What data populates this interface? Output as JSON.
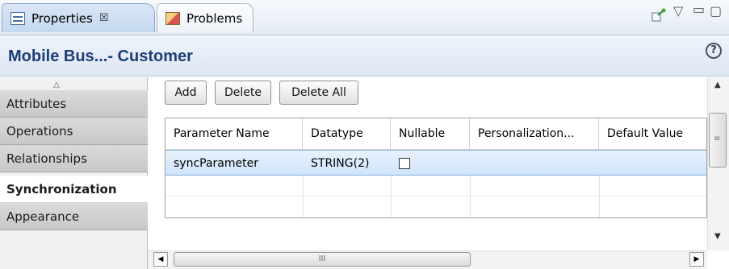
{
  "tabs": [
    {
      "label": "Properties",
      "close": "☒"
    },
    {
      "label": "Problems"
    }
  ],
  "toolbar": {
    "pin_icon": "pin-icon",
    "menu_icon": "▽",
    "minimize_icon": "▭",
    "maximize_icon": "▢"
  },
  "title": "Mobile Bus...- Customer",
  "help": "?",
  "nav": {
    "items": [
      {
        "label": "Attributes"
      },
      {
        "label": "Operations"
      },
      {
        "label": "Relationships"
      },
      {
        "label": "Synchronization"
      },
      {
        "label": "Appearance"
      }
    ],
    "selected": "Synchronization"
  },
  "buttons": {
    "add": "Add",
    "delete": "Delete",
    "delete_all": "Delete All"
  },
  "table": {
    "columns": [
      "Parameter Name",
      "Datatype",
      "Nullable",
      "Personalization...",
      "Default Value"
    ],
    "rows": [
      {
        "parameter_name": "syncParameter",
        "datatype": "STRING(2)",
        "nullable": false,
        "personalization": "",
        "default_value": ""
      }
    ]
  },
  "scroll": {
    "h_grip": "III"
  },
  "colors": {
    "title": "#1d3f78",
    "selected_row": "#cfe3fb"
  }
}
